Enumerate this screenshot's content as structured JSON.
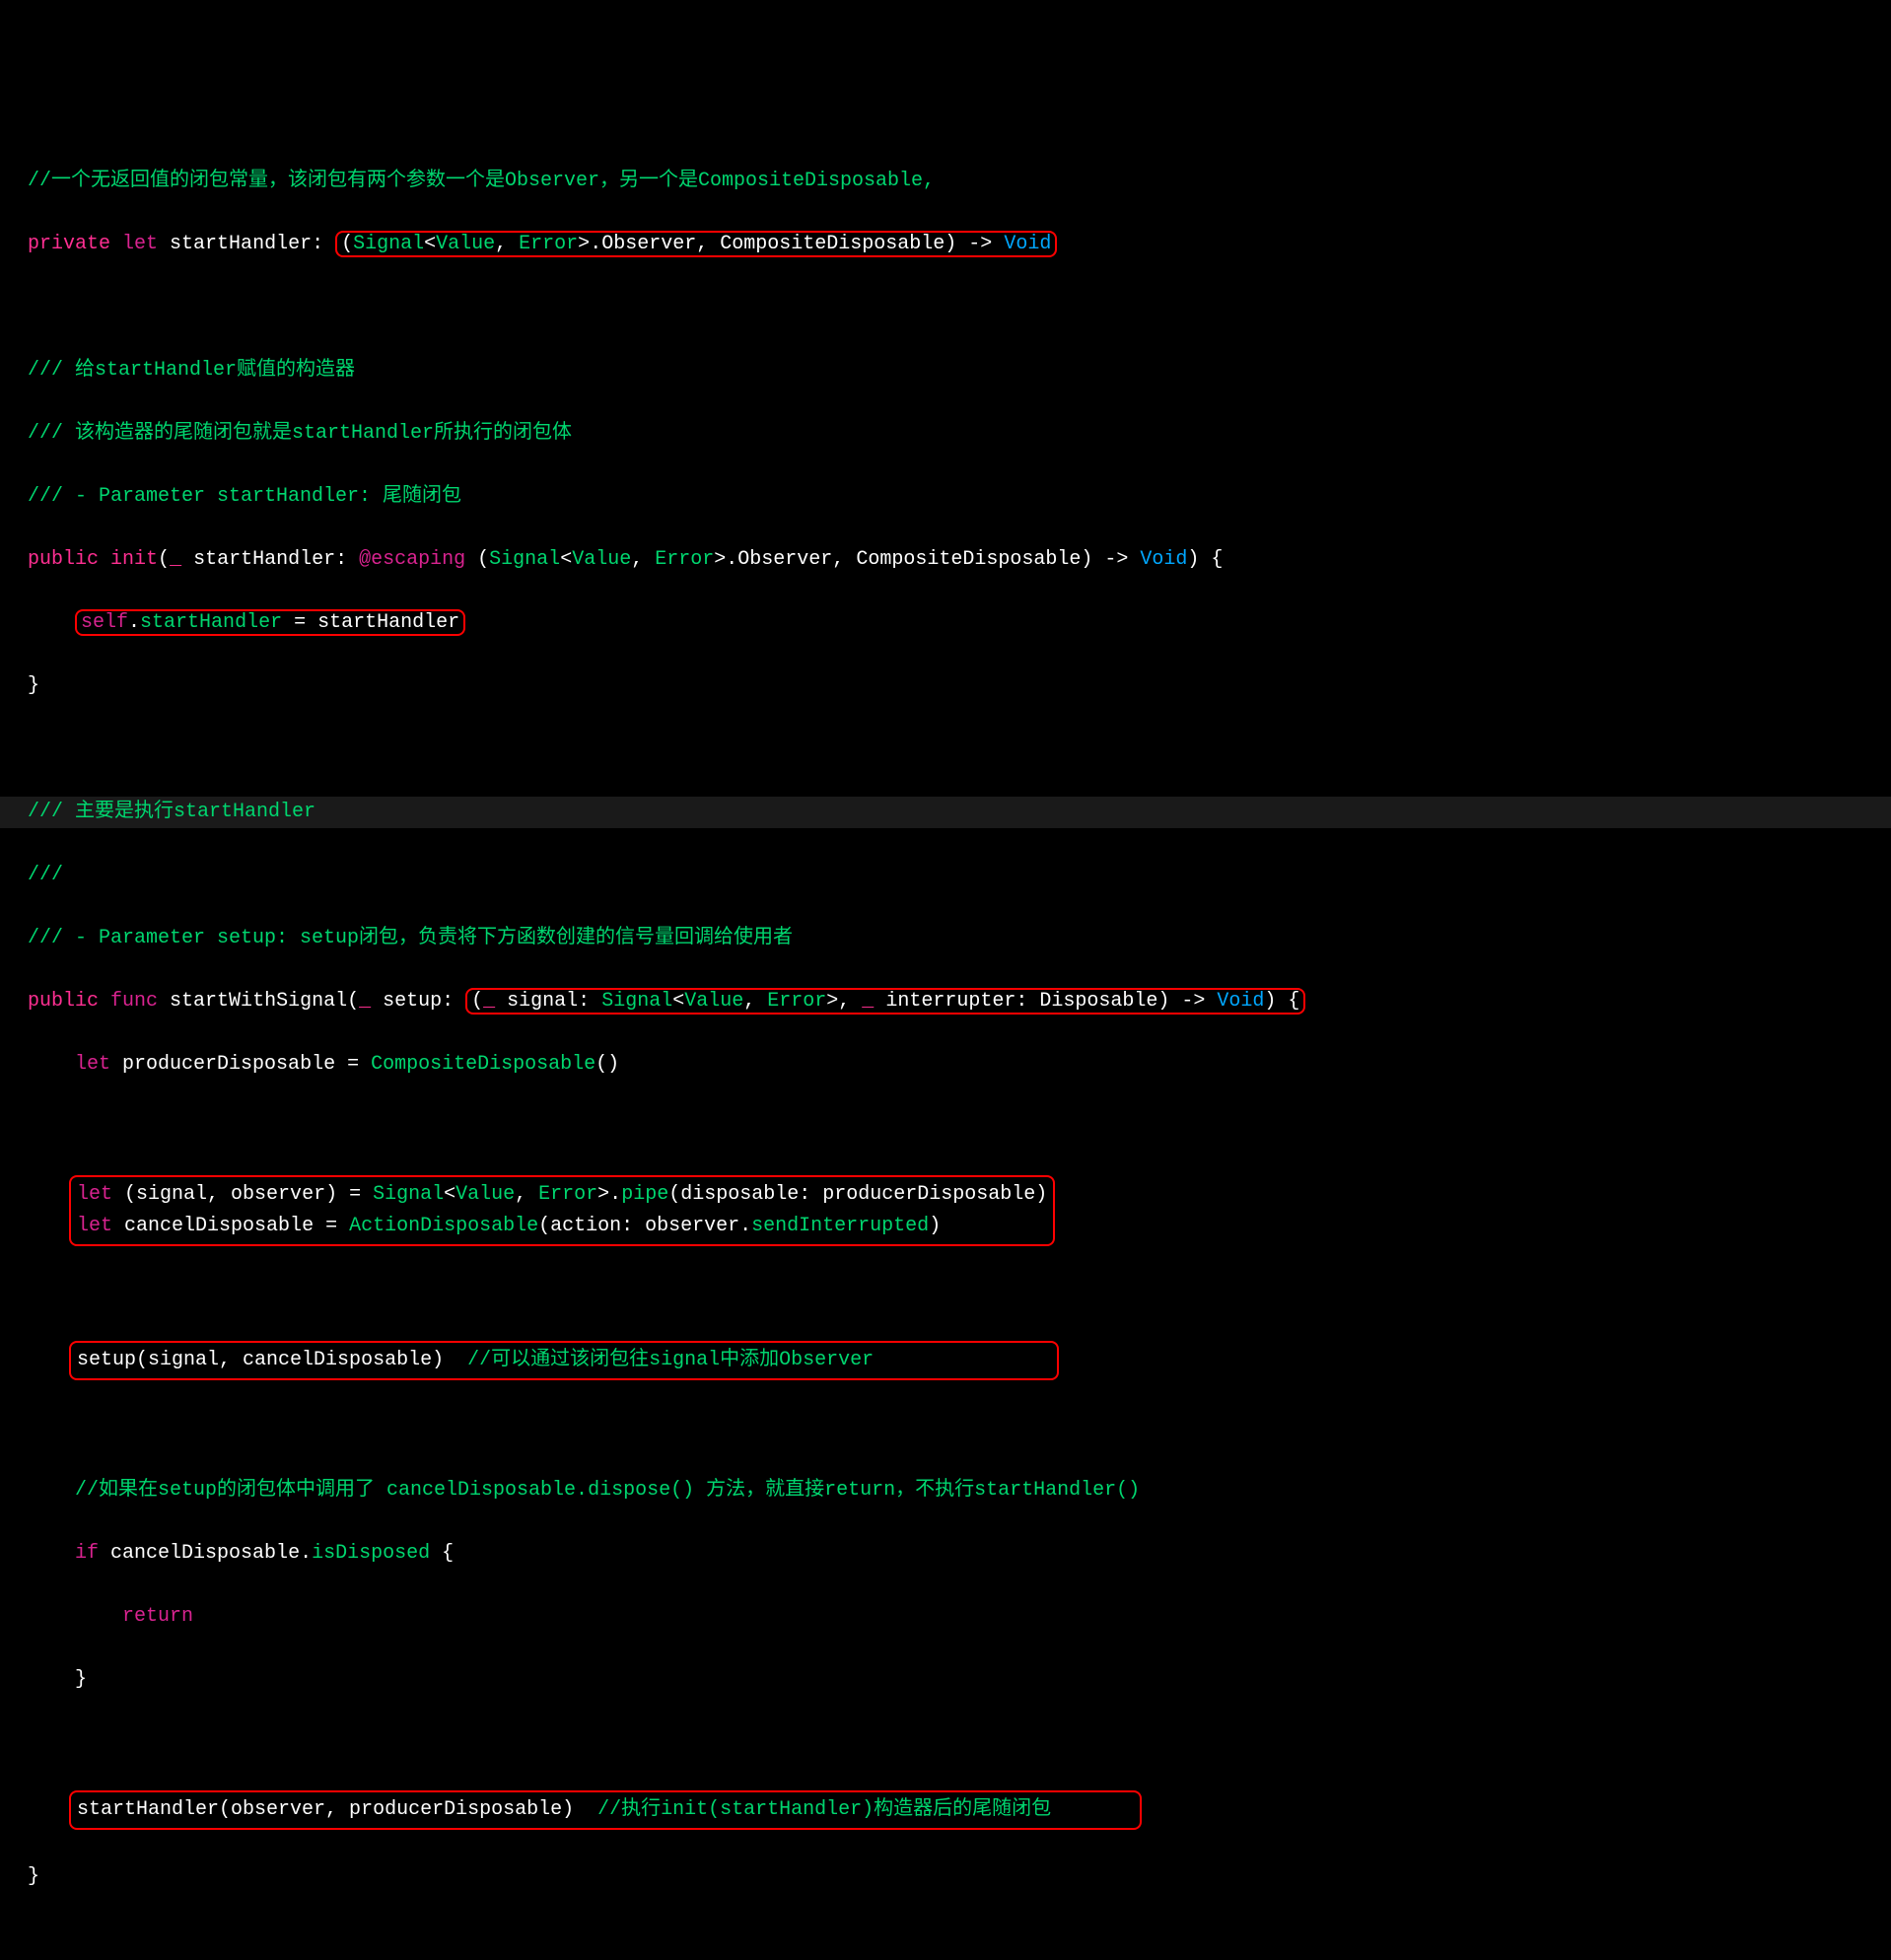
{
  "code": {
    "l1": "//一个无返回值的闭包常量，该闭包有两个参数一个是Observer，另一个是CompositeDisposable,",
    "l2_private": "private",
    "l2_let": "let",
    "l2_name": " startHandler: ",
    "l2_box_open": "(",
    "l2_signal": "Signal",
    "l2_lt": "<",
    "l2_value": "Value",
    "l2_comma1": ", ",
    "l2_error": "Error",
    "l2_gt": ">",
    "l2_dot": ".",
    "l2_observer": "Observer",
    "l2_comma2": ", ",
    "l2_compdisp": "CompositeDisposable",
    "l2_close": ")",
    "l2_arrow": " -> ",
    "l2_void": "Void",
    "l4": "/// 给startHandler赋值的构造器",
    "l5": "/// 该构造器的尾随闭包就是startHandler所执行的闭包体",
    "l6": "/// - Parameter startHandler: 尾随闭包",
    "l7_public": "public",
    "l7_init": "init",
    "l7_open": "(",
    "l7_underscore": "_",
    "l7_label": " startHandler: ",
    "l7_escaping": "@escaping",
    "l7_sp": " ",
    "l7_popen": "(",
    "l7_signal": "Signal",
    "l7_lt": "<",
    "l7_value": "Value",
    "l7_comma1": ", ",
    "l7_error": "Error",
    "l7_gt": ">",
    "l7_dot": ".",
    "l7_observer": "Observer",
    "l7_comma2": ", ",
    "l7_compdisp": "CompositeDisposable",
    "l7_pclose": ")",
    "l7_arrow": " -> ",
    "l7_void": "Void",
    "l7_close": ") {",
    "l8_self": "self",
    "l8_dot": ".",
    "l8_startHandler": "startHandler",
    "l8_eq": " = startHandler",
    "l9": "}",
    "l11": "/// 主要是执行startHandler",
    "l12": "///",
    "l13": "/// - Parameter setup: setup闭包，负责将下方函数创建的信号量回调给使用者",
    "l14_public": "public",
    "l14_func": "func",
    "l14_name": " startWithSignal(",
    "l14_underscore1": "_",
    "l14_setup": " setup: ",
    "l14_box_open": "(",
    "l14_underscore2": "_",
    "l14_signal_label": " signal: ",
    "l14_signal": "Signal",
    "l14_lt": "<",
    "l14_value": "Value",
    "l14_comma1": ", ",
    "l14_error": "Error",
    "l14_gt": ">",
    "l14_comma2": ", ",
    "l14_underscore3": "_",
    "l14_int_label": " interrupter: ",
    "l14_disposable": "Disposable",
    "l14_pclose": ")",
    "l14_arrow": " -> ",
    "l14_void": "Void",
    "l14_close": ") {",
    "l15_let": "let",
    "l15_body": " producerDisposable = ",
    "l15_type": "CompositeDisposable",
    "l15_call": "()",
    "l17_let": "let",
    "l17_tuple": " (signal, observer) = ",
    "l17_signal": "Signal",
    "l17_lt": "<",
    "l17_value": "Value",
    "l17_comma": ", ",
    "l17_error": "Error",
    "l17_gt": ">",
    "l17_dot": ".",
    "l17_pipe": "pipe",
    "l17_args": "(disposable: producerDisposable)",
    "l18_let": "let",
    "l18_name": " cancelDisposable = ",
    "l18_type": "ActionDisposable",
    "l18_open": "(action: observer.",
    "l18_send": "sendInterrupted",
    "l18_close": ")",
    "l20_setup": "setup(signal, cancelDisposable)  ",
    "l20_comment": "//可以通过该闭包往signal中添加Observer",
    "l22": "//如果在setup的闭包体中调用了 cancelDisposable.dispose() 方法，就直接return，不执行startHandler()",
    "l23_if": "if",
    "l23_cond": " cancelDisposable.",
    "l23_isDisposed": "isDisposed",
    "l23_brace": " {",
    "l24_return": "return",
    "l25": "}",
    "l27_call": "startHandler(observer, producerDisposable)  ",
    "l27_comment": "//执行init(startHandler)构造器后的尾随闭包",
    "l28": "}"
  }
}
